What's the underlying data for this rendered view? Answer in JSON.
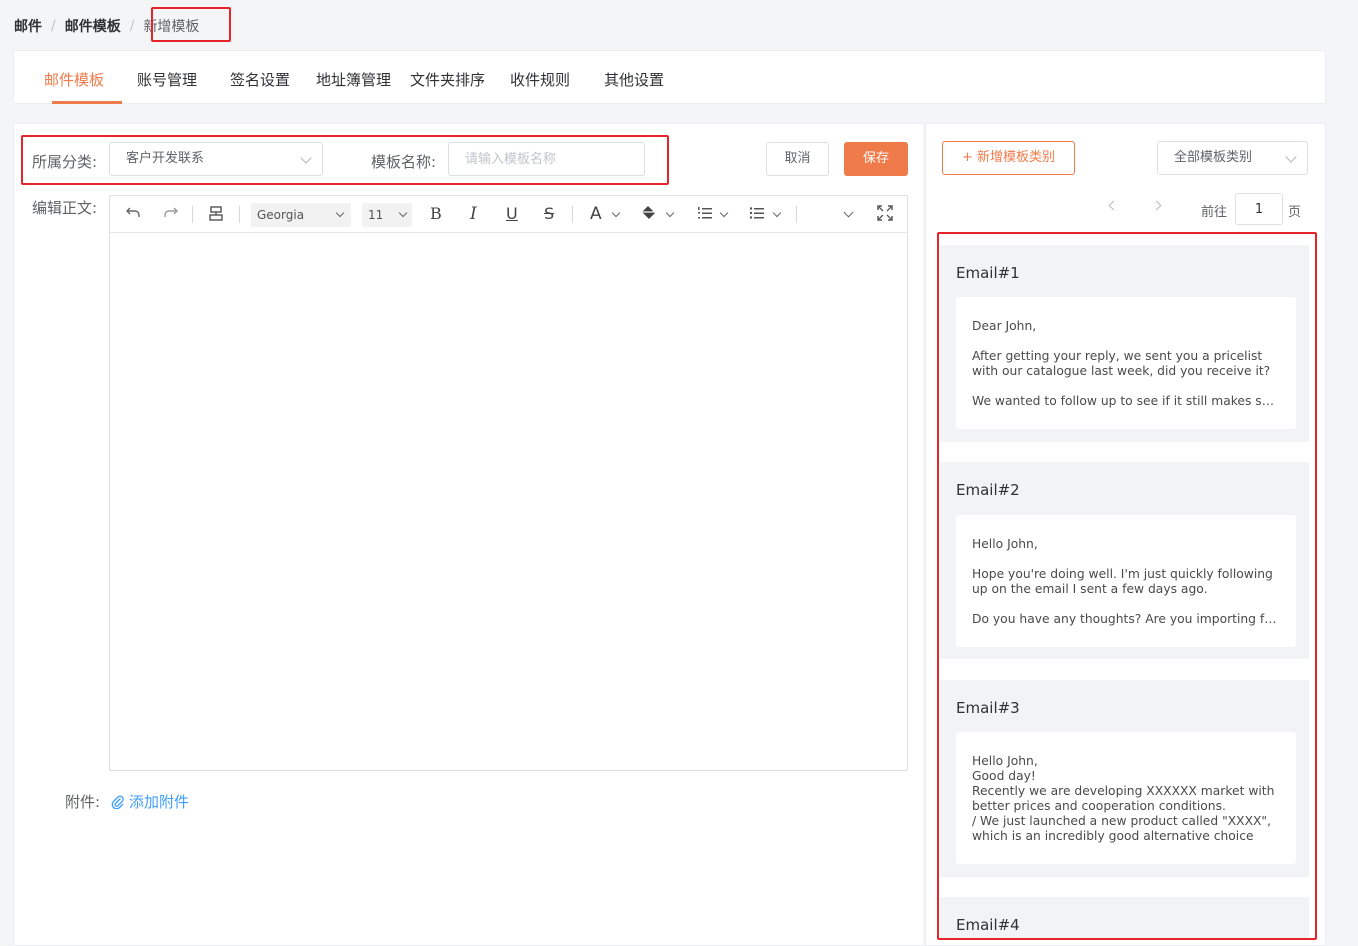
{
  "breadcrumb": {
    "level1": "邮件",
    "level2": "邮件模板",
    "current": "新增模板",
    "separator": "/"
  },
  "tabs": [
    {
      "label": "邮件模板",
      "active": true
    },
    {
      "label": "账号管理"
    },
    {
      "label": "签名设置"
    },
    {
      "label": "地址簿管理"
    },
    {
      "label": "文件夹排序"
    },
    {
      "label": "收件规则"
    },
    {
      "label": "其他设置"
    }
  ],
  "form": {
    "category_label": "所属分类:",
    "category_value": "客户开发联系",
    "name_label": "模板名称:",
    "name_placeholder": "请输入模板名称",
    "body_label": "编辑正文:",
    "cancel_label": "取消",
    "save_label": "保存"
  },
  "editor": {
    "font_family": "Georgia",
    "font_size": "11",
    "bold": "B",
    "italic": "I",
    "underline": "U",
    "strike": "S",
    "text_color": "A"
  },
  "attachment": {
    "label": "附件:",
    "link_label": "添加附件"
  },
  "right_panel": {
    "add_category_label": "+ 新增模板类别",
    "filter_value": "全部模板类别",
    "pager": {
      "goto_label": "前往",
      "page_value": "1",
      "page_suffix": "页"
    },
    "templates": [
      {
        "title": "Email#1",
        "paragraphs": [
          "Dear John,",
          "After getting your reply, we sent you a pricelist with our catalogue last week, did you receive it?",
          "We wanted to follow up to see if it still makes sense to talk about working together."
        ]
      },
      {
        "title": "Email#2",
        "paragraphs": [
          "Hello John,",
          "Hope you're doing well. I'm just quickly following up on the email I sent a few days ago.",
          "Do you have any thoughts? Are you importing from China now?"
        ]
      },
      {
        "title": "Email#3",
        "lines": [
          "Hello John,",
          "Good day!",
          "Recently we are developing XXXXXX market with better prices and cooperation conditions.",
          "/ We just launched a new product called \"XXXX\", which is an incredibly good alternative choice of..."
        ]
      },
      {
        "title": "Email#4"
      }
    ]
  },
  "colors": {
    "accent": "#f07b4a",
    "link": "#409eff",
    "highlight": "#e8242b"
  }
}
